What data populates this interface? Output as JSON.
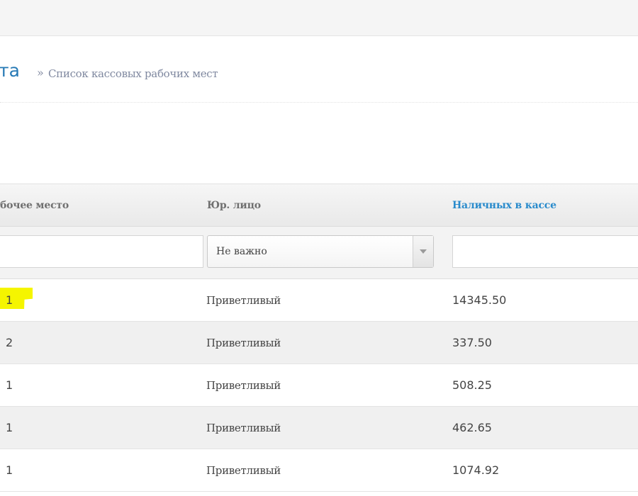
{
  "header": {
    "title_fragment": "та",
    "breadcrumb_separator": "»",
    "breadcrumb_current": "Список кассовых рабочих мест"
  },
  "table": {
    "columns": [
      {
        "label": "бочее место"
      },
      {
        "label": "Юр. лицо"
      },
      {
        "label": "Наличных в кассе",
        "sortable_link": true
      }
    ],
    "filters": {
      "workplace_value": "",
      "entity_select_value": "Не важно",
      "cash_value": ""
    },
    "rows": [
      {
        "workplace": "1",
        "entity": "Приветливый",
        "cash": "14345.50",
        "highlighted": true
      },
      {
        "workplace": "2",
        "entity": "Приветливый",
        "cash": "337.50"
      },
      {
        "workplace": "1",
        "entity": "Приветливый",
        "cash": "508.25"
      },
      {
        "workplace": "1",
        "entity": "Приветливый",
        "cash": "462.65"
      },
      {
        "workplace": "1",
        "entity": "Приветливый",
        "cash": "1074.92"
      }
    ]
  },
  "colors": {
    "title_blue": "#2679b5",
    "link_blue": "#2a8bcc",
    "highlight_yellow": "#f5f500"
  },
  "icons": {
    "select_arrow": "chevron-down-icon"
  }
}
